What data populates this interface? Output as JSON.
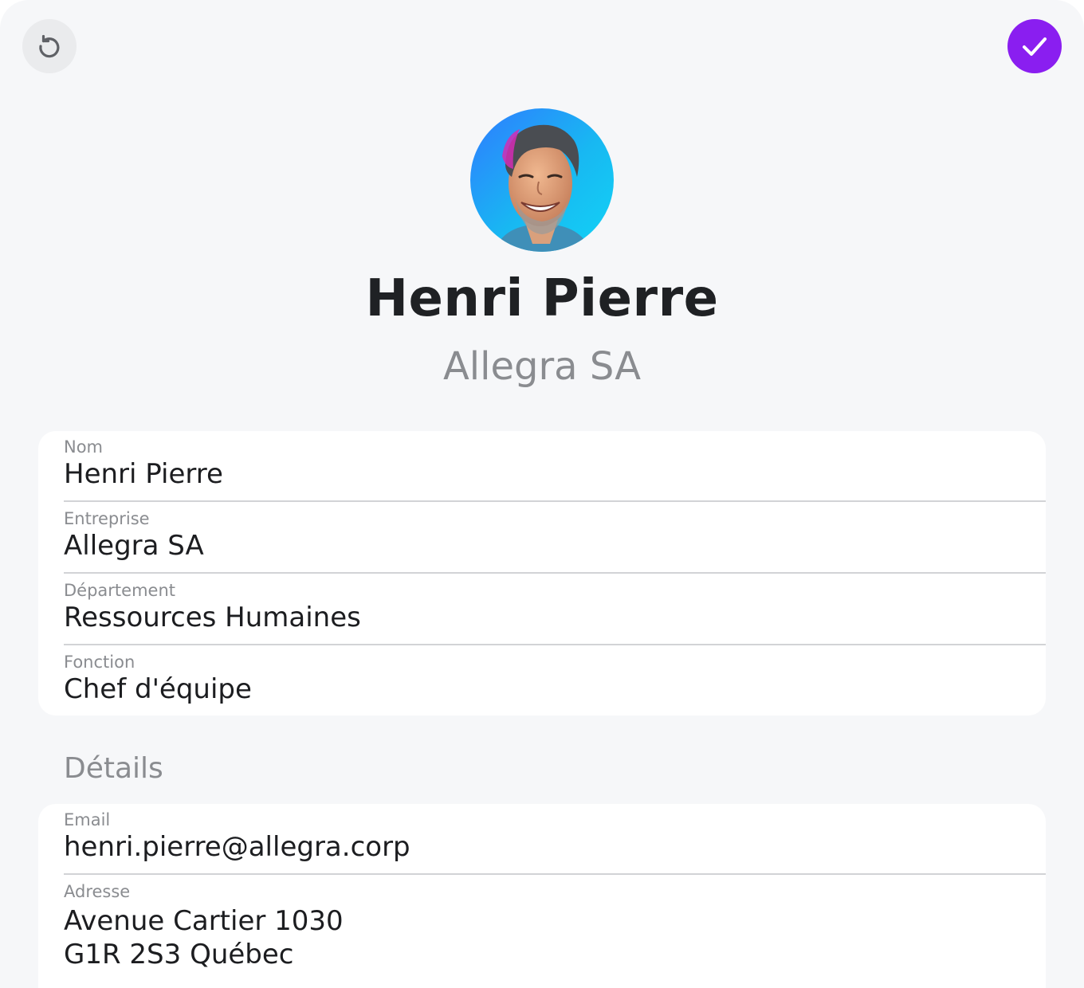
{
  "profile": {
    "name": "Henri Pierre",
    "company": "Allegra SA"
  },
  "actions": {
    "undo_icon": "undo-icon",
    "confirm_icon": "checkmark-icon",
    "confirm_color": "#8a1ef0"
  },
  "main_fields": [
    {
      "label": "Nom",
      "value": "Henri Pierre"
    },
    {
      "label": "Entreprise",
      "value": "Allegra SA"
    },
    {
      "label": "Département",
      "value": "Ressources Humaines"
    },
    {
      "label": "Fonction",
      "value": "Chef d'équipe"
    }
  ],
  "details": {
    "header": "Détails",
    "email": {
      "label": "Email",
      "value": "henri.pierre@allegra.corp"
    },
    "address": {
      "label": "Adresse",
      "lines": [
        "Avenue Cartier 1030",
        "G1R 2S3 Québec"
      ]
    }
  }
}
